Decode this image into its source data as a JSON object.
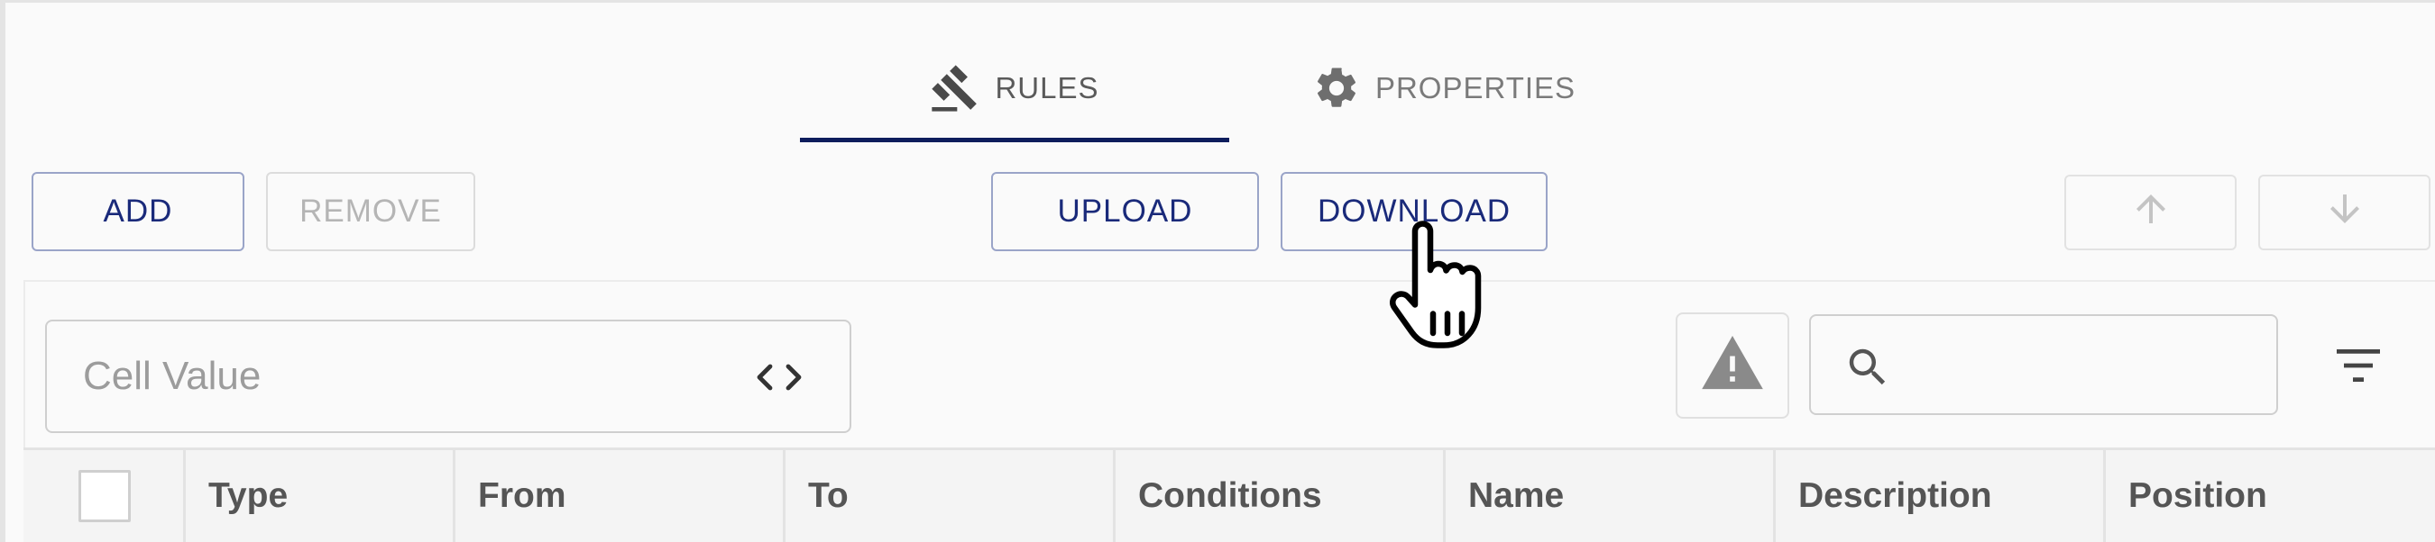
{
  "tabs": [
    {
      "label": "RULES",
      "icon": "gavel-icon",
      "active": true
    },
    {
      "label": "PROPERTIES",
      "icon": "gear-icon",
      "active": false
    }
  ],
  "toolbar": {
    "add_label": "ADD",
    "remove_label": "REMOVE",
    "upload_label": "UPLOAD",
    "download_label": "DOWNLOAD",
    "move_up_icon": "arrow-up-icon",
    "move_down_icon": "arrow-down-icon"
  },
  "filter_bar": {
    "cell_value_placeholder": "Cell Value",
    "code_icon": "code-brackets-icon",
    "warning_icon": "warning-icon",
    "search_value": "",
    "filter_icon": "filter-icon"
  },
  "table": {
    "columns": [
      "Type",
      "From",
      "To",
      "Conditions",
      "Name",
      "Description",
      "Position"
    ]
  },
  "colors": {
    "accent": "#0d1d5c",
    "button_text": "#1a2a7a",
    "disabled": "#b5b5b5"
  }
}
